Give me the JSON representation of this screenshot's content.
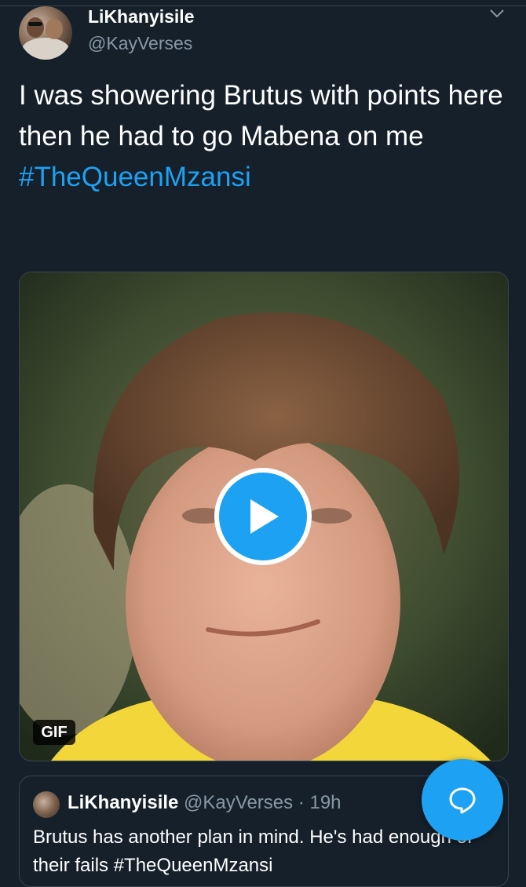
{
  "tweet": {
    "author_name": "LiKhanyisile",
    "author_handle": "@KayVerses",
    "text": "I was showering Brutus with points here then he had to go Mabena on me",
    "hashtag": "#TheQueenMzansi",
    "media": {
      "badge": "GIF",
      "play_icon": "play-icon"
    }
  },
  "quoted_tweet": {
    "author_name": "LiKhanyisile",
    "author_handle": "@KayVerses",
    "separator": "·",
    "time": "19h",
    "text": "Brutus has another plan in mind. He's had enough of their fails #TheQueenMzansi"
  },
  "fab": {
    "icon": "compose-reply-icon"
  },
  "colors": {
    "background": "#15202b",
    "accent": "#1da1f2",
    "secondary_text": "#8899a6",
    "border": "#38444d"
  }
}
